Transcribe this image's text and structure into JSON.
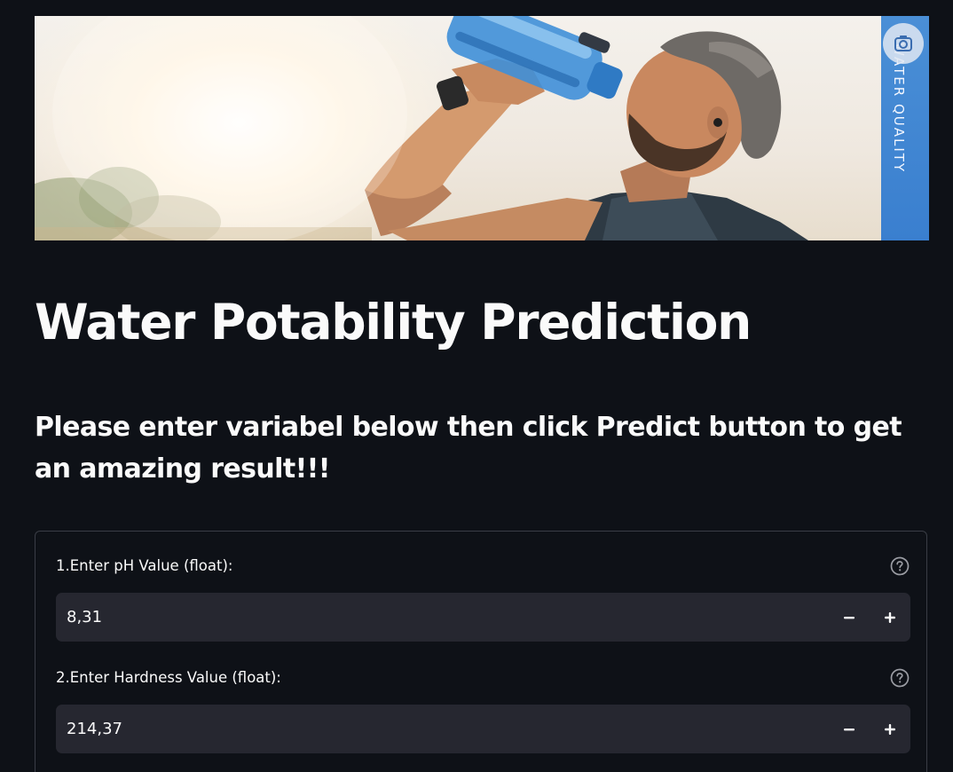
{
  "hero": {
    "tag_text": "WATER QUALITY",
    "image": "man-drinking-from-water-bottle-photo",
    "badge_icon": "camera-icon",
    "tag_color": "#3a7fcf"
  },
  "title": "Water Potability Prediction",
  "subtitle": "Please enter variabel below then click Predict button to get an amazing result!!!",
  "form": {
    "fields": [
      {
        "label": "1.Enter pH Value (float):",
        "value": "8,31",
        "help_icon": "question-circle-icon",
        "decrement_icon": "minus-icon",
        "increment_icon": "plus-icon"
      },
      {
        "label": "2.Enter Hardness Value (float):",
        "value": "214,37",
        "help_icon": "question-circle-icon",
        "decrement_icon": "minus-icon",
        "increment_icon": "plus-icon"
      }
    ]
  },
  "colors": {
    "background": "#0e1117",
    "input_background": "#262730",
    "text": "#fafafa",
    "border": "#3a3d46"
  }
}
